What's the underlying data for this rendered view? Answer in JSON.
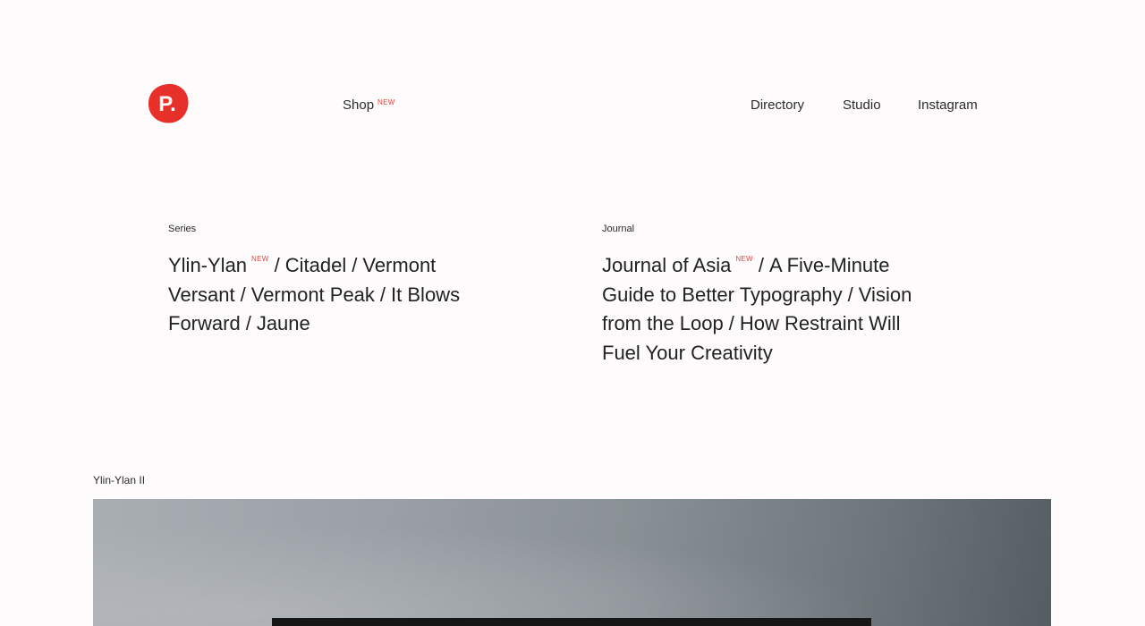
{
  "logo": {
    "letter": "P.",
    "color": "#e8302a"
  },
  "nav": {
    "shop": {
      "label": "Shop",
      "badge": "NEW"
    },
    "directory": "Directory",
    "studio": "Studio",
    "instagram": "Instagram"
  },
  "series": {
    "label": "Series",
    "items": [
      {
        "title": "Ylin-Ylan",
        "badge": "NEW"
      },
      {
        "title": "Citadel"
      },
      {
        "title": "Vermont Versant"
      },
      {
        "title": "Vermont Peak"
      },
      {
        "title": "It Blows Forward"
      },
      {
        "title": "Jaune"
      }
    ]
  },
  "journal": {
    "label": "Journal",
    "items": [
      {
        "title": "Journal of Asia",
        "badge": "NEW"
      },
      {
        "title": "A Five-Minute Guide to Better Typography"
      },
      {
        "title": "Vision from the Loop"
      },
      {
        "title": "How Restraint Will Fuel Your Creativity"
      }
    ]
  },
  "feature": {
    "caption": "Ylin-Ylan II"
  },
  "colors": {
    "accent": "#e8453c",
    "background": "#fdfbfb",
    "text": "#2b2b2b"
  }
}
